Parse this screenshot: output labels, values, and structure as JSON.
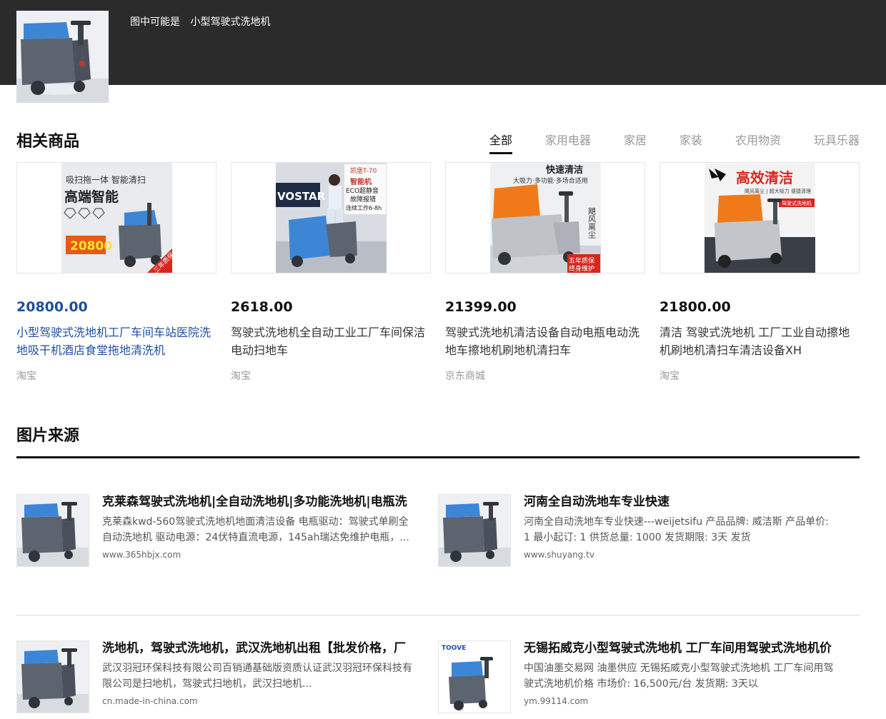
{
  "header": {
    "prefix": "图中可能是",
    "label": "小型驾驶式洗地机"
  },
  "products_section": {
    "title": "相关商品",
    "tabs": [
      {
        "label": "全部",
        "active": true
      },
      {
        "label": "家用电器",
        "active": false
      },
      {
        "label": "家居",
        "active": false
      },
      {
        "label": "家装",
        "active": false
      },
      {
        "label": "农用物资",
        "active": false
      },
      {
        "label": "玩具乐器",
        "active": false
      }
    ],
    "items": [
      {
        "price": "20800.00",
        "title": "小型驾驶式洗地机工厂车间车站医院洗地吸干机酒店食堂拖地清洗机",
        "shop": "淘宝",
        "img_text": {
          "line1": "吸扫拖一体 智能清扫",
          "line2": "高端智能",
          "price_badge": "20800",
          "corner": "三年质保"
        }
      },
      {
        "price": "2618.00",
        "title": "驾驶式洗地机全自动工业工厂车间保洁电动扫地车",
        "shop": "淘宝",
        "img_text": {
          "line1": "凯堡T-70",
          "line2": "智能机",
          "line3": "ECO超静音",
          "line4": "故障报错",
          "line5": "连续工作6-8h",
          "side": "VOSTAR"
        }
      },
      {
        "price": "21399.00",
        "title": "驾驶式洗地机清洁设备自动电瓶电动洗地车擦地机刷地机清扫车",
        "shop": "京东商城",
        "img_text": {
          "line1": "快速清洁",
          "line2": "大吸力·多功能·多场合适用",
          "side": "飓风离尘",
          "badge1": "五年质保",
          "badge2": "终身维护"
        }
      },
      {
        "price": "21800.00",
        "title": "清洁 驾驶式洗地机 工厂工业自动擦地机刷地机清扫车清洁设备XH",
        "shop": "淘宝",
        "img_text": {
          "line1": "高效清洁",
          "line2": "飓风离尘 | 超大吸力 便捷清理",
          "badge": "驾驶式洗地机"
        }
      }
    ]
  },
  "sources_section": {
    "title": "图片来源",
    "items": [
      {
        "title": "克莱森驾驶式洗地机|全自动洗地机|多功能洗地机|电瓶洗",
        "desc": "克莱森kwd-560驾驶式洗地机地面清洁设备 电瓶驱动：驾驶式单刷全自动洗地机 驱动电源：24伏特直流电源，145ah瑞达免维护电瓶，...",
        "url": "www.365hbjx.com"
      },
      {
        "title": "河南全自动洗地车专业快速",
        "desc": "河南全自动洗地车专业快速---weijetsifu 产品品牌: 威洁斯 产品单价: 1 最小起订: 1 供货总量: 1000 发货期限: 3天 发货",
        "url": "www.shuyang.tv"
      },
      {
        "title": "洗地机，驾驶式洗地机，武汉洗地机出租【批发价格，厂",
        "desc": "武汉羽冠环保科技有限公司百销通基础版资质认证武汉羽冠环保科技有限公司是扫地机，驾驶式扫地机，武汉扫地机...",
        "url": "cn.made-in-china.com"
      },
      {
        "title": "无锡拓威克小型驾驶式洗地机 工厂车间用驾驶式洗地机价",
        "desc": "中国油墨交易网 油墨供应 无锡拓威克小型驾驶式洗地机 工厂车间用驾驶式洗地机价格 市场价: 16,500元/台 发货期: 3天以",
        "url": "ym.99114.com",
        "logo": "TOOVE"
      }
    ]
  },
  "colors": {
    "header_bg": "#2b2b2b",
    "accent_blue": "#1d4fa0",
    "machine_blue": "#3d86d6",
    "machine_gray": "#5c6470",
    "machine_orange": "#f07a1a"
  }
}
